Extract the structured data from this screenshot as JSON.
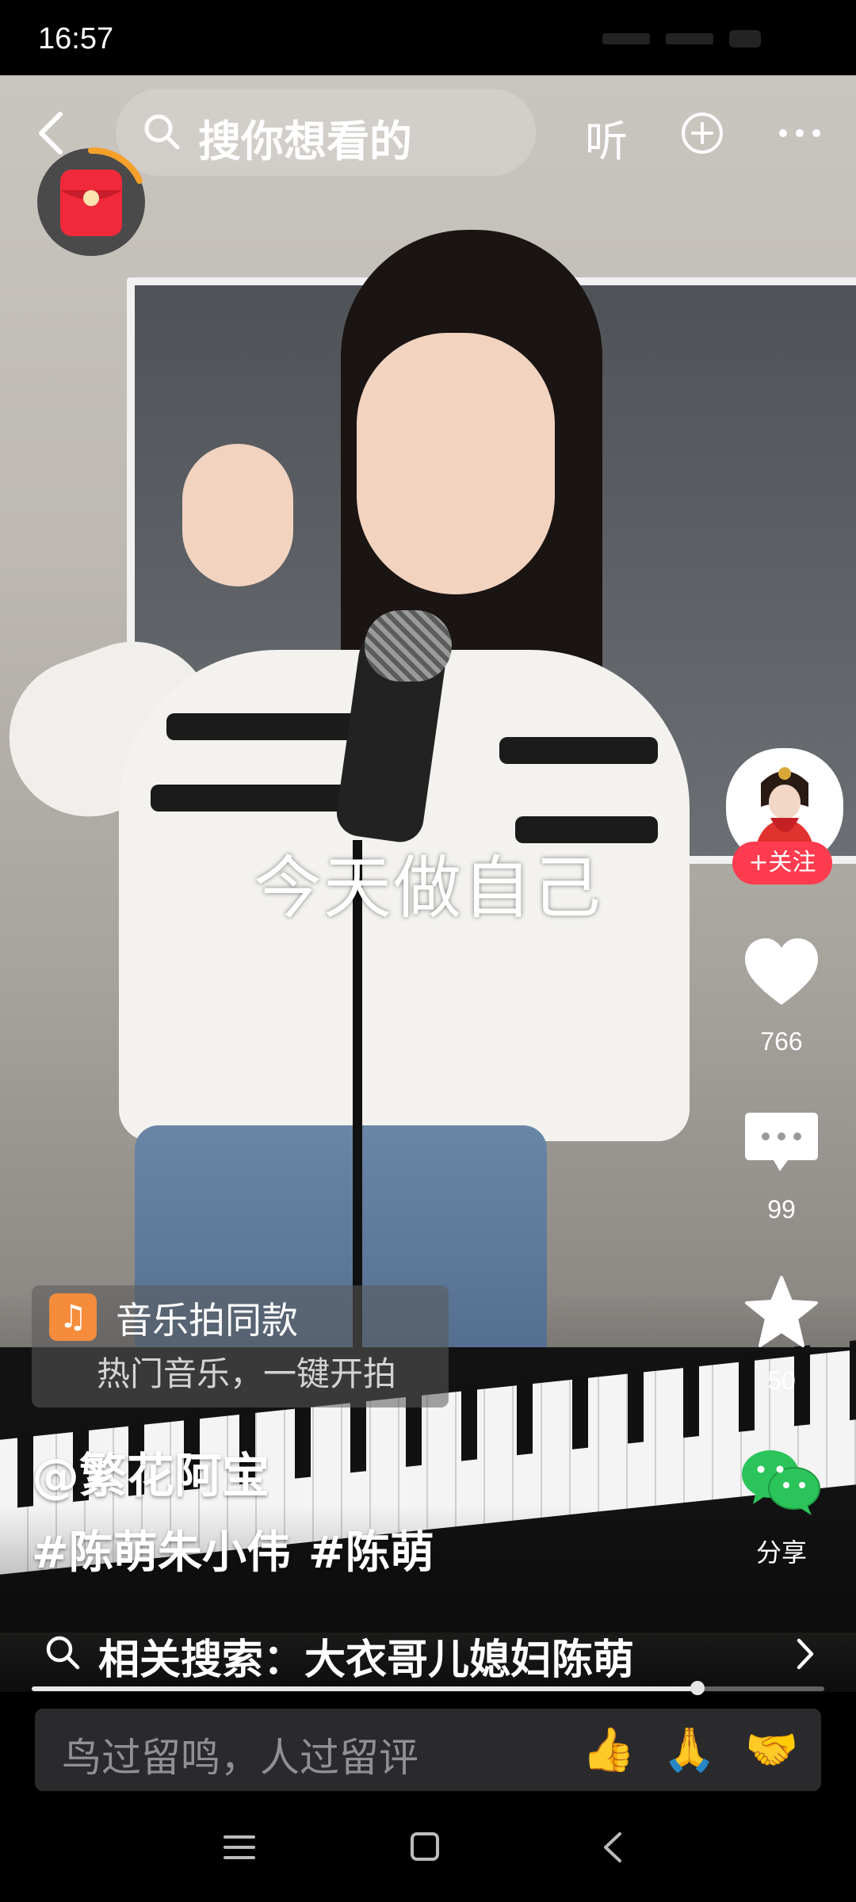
{
  "status_bar": {
    "time": "16:57"
  },
  "top_bar": {
    "search_placeholder": "搜你想看的",
    "listen_label": "听"
  },
  "video": {
    "caption": "今天做自己"
  },
  "right_rail": {
    "follow_label": "+关注",
    "like_count": "766",
    "comment_count": "99",
    "favorite_count": "50",
    "share_label": "分享"
  },
  "music_card": {
    "title": "音乐拍同款",
    "subtitle": "热门音乐，一键开拍"
  },
  "post": {
    "author": "@繁花阿宝",
    "tags": [
      "#陈萌朱小伟",
      "#陈萌"
    ]
  },
  "related_search": {
    "text": "相关搜索：大衣哥儿媳妇陈萌"
  },
  "progress": {
    "fraction": 0.84
  },
  "comment_bar": {
    "placeholder": "鸟过留鸣，人过留评",
    "emojis": [
      "👍",
      "🙏",
      "🤝"
    ]
  },
  "colors": {
    "follow_red": "#ff3b4f",
    "music_orange": "#f58c3b",
    "share_green": "#2bc45a"
  }
}
